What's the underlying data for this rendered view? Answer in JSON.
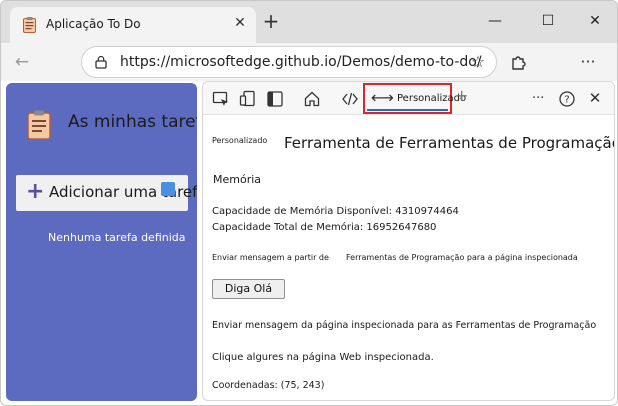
{
  "browser": {
    "tab_title": "Aplicação To Do",
    "url": "https://microsoftedge.github.io/Demos/demo-to-do/",
    "window_controls": {
      "minimize": "—",
      "maximize": "☐",
      "close": "✕"
    },
    "new_tab": "+",
    "tab_close": "✕"
  },
  "app": {
    "title": "As minhas tarefas",
    "add_task_label": "Adicionar uma tarefa",
    "add_task_symbol": "+",
    "empty_message": "Nenhuma tarefa definida",
    "panel_color": "#5c6bc0"
  },
  "devtools": {
    "active_tab_label": "Personalizado",
    "active_tab_arrow": "⟷",
    "add_tab": "+",
    "more_menu": "···",
    "help": "?",
    "close": "✕",
    "panel": {
      "small_label": "Personalizado",
      "title": "Ferramenta de Ferramentas de Programação",
      "memory_heading": "Memória",
      "memory_available": "Capacidade de Memória Disponível: 4310974464",
      "memory_total": "Capacidade Total de Memória: 16952647680",
      "send_from_label": "Enviar mensagem a partir de",
      "send_from_target": "Ferramentas de Programação para a página inspecionada",
      "button_label": "Diga Olá",
      "send_to_label": "Enviar mensagem da página inspecionada para as Ferramentas de Programação",
      "click_hint": "Clique algures na página Web inspecionada.",
      "coordinates": "Coordenadas: (75, 243)"
    },
    "highlight_color": "#d62828",
    "underline_color": "#1f6fc5"
  }
}
